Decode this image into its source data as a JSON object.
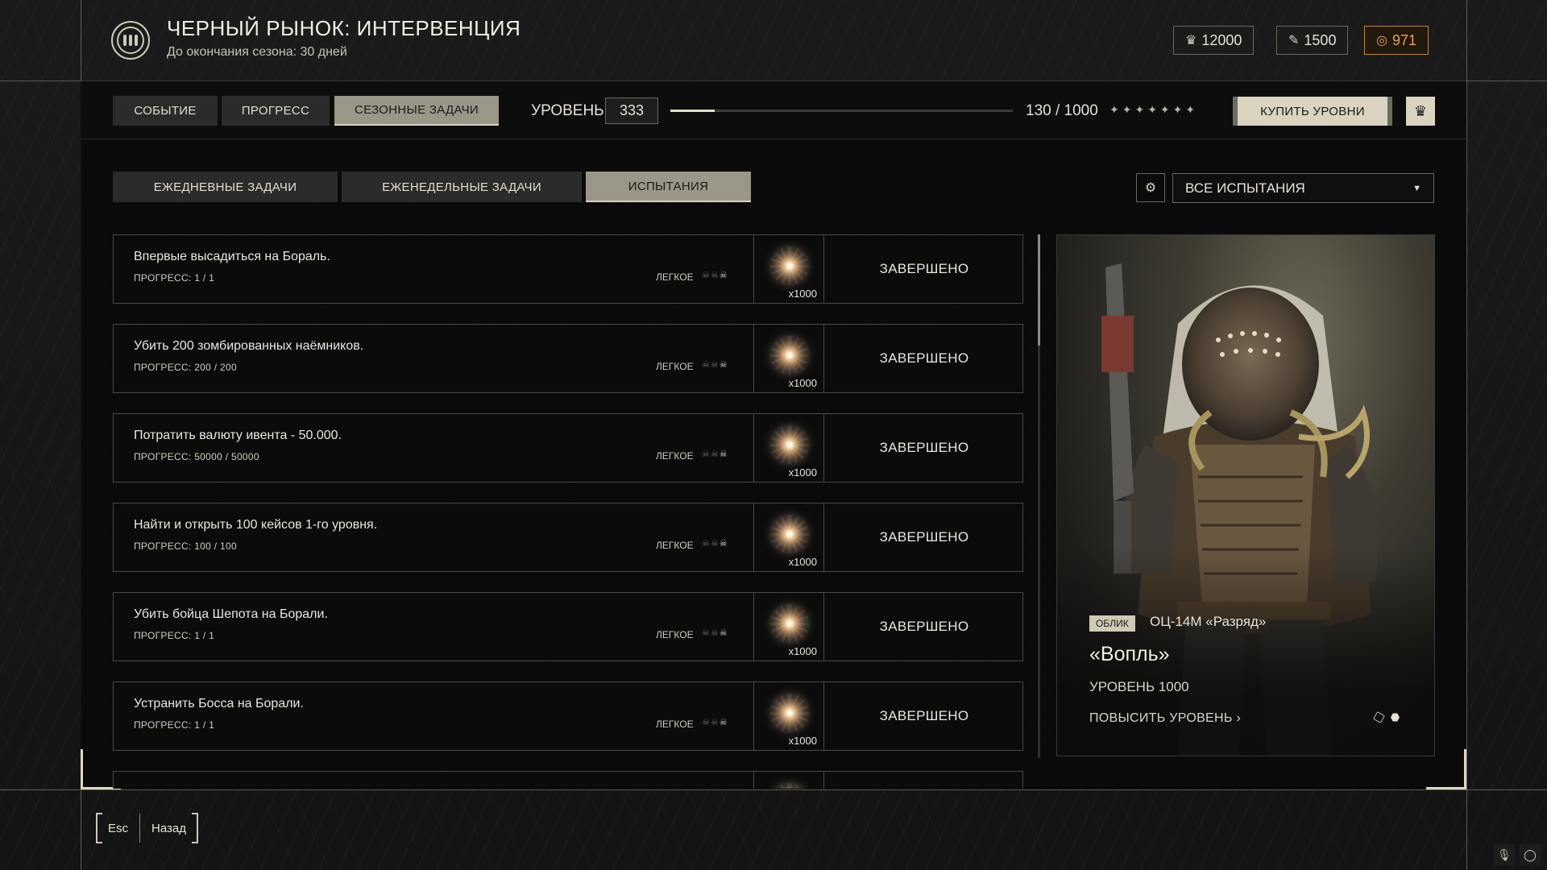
{
  "header": {
    "title": "ЧЕРНЫЙ РЫНОК: ИНТЕРВЕНЦИЯ",
    "subtitle": "До окончания сезона: 30 дней",
    "currencies": [
      {
        "icon": "crown-currency-icon",
        "value": "12000"
      },
      {
        "icon": "feather-currency-icon",
        "value": "1500"
      },
      {
        "icon": "coin-currency-icon",
        "value": "971"
      }
    ]
  },
  "tabs": [
    "СОБЫТИЕ",
    "ПРОГРЕСС",
    "СЕЗОННЫЕ ЗАДАЧИ"
  ],
  "active_tab": "СЕЗОННЫЕ ЗАДАЧИ",
  "level": {
    "label": "УРОВЕНЬ",
    "value": "333",
    "progress_text": "130 / 1000",
    "progress_fraction": 0.13,
    "stars": "✦✦✦✦✦✦✦"
  },
  "buy_levels_label": "КУПИТЬ УРОВНИ",
  "subtabs": [
    "ЕЖЕДНЕВНЫЕ ЗАДАЧИ",
    "ЕЖЕНЕДЕЛЬНЫЕ ЗАДАЧИ",
    "ИСПЫТАНИЯ"
  ],
  "active_subtab": "ИСПЫТАНИЯ",
  "filter": {
    "selected": "ВСЕ ИСПЫТАНИЯ"
  },
  "tasks": [
    {
      "name": "Впервые высадиться на Бораль.",
      "progress": "ПРОГРЕСС: 1 / 1",
      "difficulty": "ЛЕГКОЕ",
      "reward_qty": "x1000",
      "status": "ЗАВЕРШЕНО"
    },
    {
      "name": "Убить 200 зомбированных наёмников.",
      "progress": "ПРОГРЕСС: 200 / 200",
      "difficulty": "ЛЕГКОЕ",
      "reward_qty": "x1000",
      "status": "ЗАВЕРШЕНО"
    },
    {
      "name": "Потратить валюту ивента - 50.000.",
      "progress": "ПРОГРЕСС: 50000 / 50000",
      "difficulty": "ЛЕГКОЕ",
      "reward_qty": "x1000",
      "status": "ЗАВЕРШЕНО"
    },
    {
      "name": "Найти и открыть 100 кейсов 1-го уровня.",
      "progress": "ПРОГРЕСС: 100 / 100",
      "difficulty": "ЛЕГКОЕ",
      "reward_qty": "x1000",
      "status": "ЗАВЕРШЕНО"
    },
    {
      "name": "Убить бойца Шепота на Борали.",
      "progress": "ПРОГРЕСС: 1 / 1",
      "difficulty": "ЛЕГКОЕ",
      "reward_qty": "x1000",
      "status": "ЗАВЕРШЕНО"
    },
    {
      "name": "Устранить Босса на Борали.",
      "progress": "ПРОГРЕСС: 1 / 1",
      "difficulty": "ЛЕГКОЕ",
      "reward_qty": "x1000",
      "status": "ЗАВЕРШЕНО"
    }
  ],
  "card": {
    "badge": "ОБЛИК",
    "weapon": "ОЦ-14М «Разряд»",
    "skin_name": "«Вопль»",
    "level": "УРОВЕНЬ 1000",
    "upgrade_label": "ПОВЫСИТЬ УРОВЕНЬ",
    "pages": 2,
    "active_page": 2
  },
  "bottom": {
    "esc_key": "Esc",
    "back_label": "Назад"
  }
}
